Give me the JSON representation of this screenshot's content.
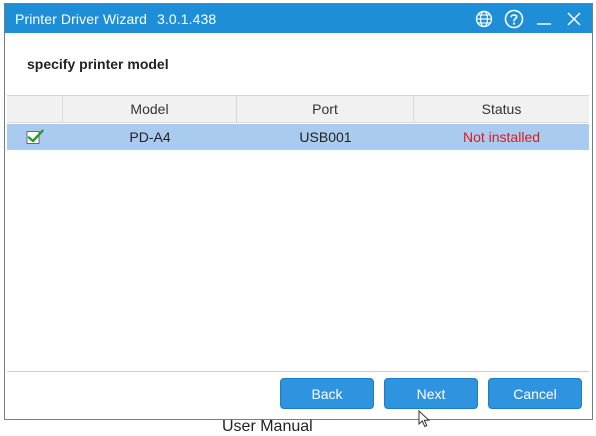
{
  "window": {
    "title": "Printer Driver Wizard",
    "version": "3.0.1.438",
    "controls": {
      "globe_icon": "globe-icon",
      "help_icon": "help-icon",
      "minimize_label": "—",
      "close_label": "✕"
    }
  },
  "page": {
    "heading": "specify printer model"
  },
  "table": {
    "headers": {
      "check": "",
      "model": "Model",
      "port": "Port",
      "status": "Status"
    },
    "rows": [
      {
        "checked": true,
        "model": "PD-A4",
        "port": "USB001",
        "status": "Not installed"
      }
    ]
  },
  "buttons": {
    "back": "Back",
    "next": "Next",
    "cancel": "Cancel"
  },
  "below_window_text": "User Manual",
  "colors": {
    "titlebar": "#1e8fd6",
    "selected_row": "#a9cbef",
    "status_not_installed": "#e8141c",
    "button": "#2f94e0",
    "checkmark": "#2a9a2a"
  }
}
